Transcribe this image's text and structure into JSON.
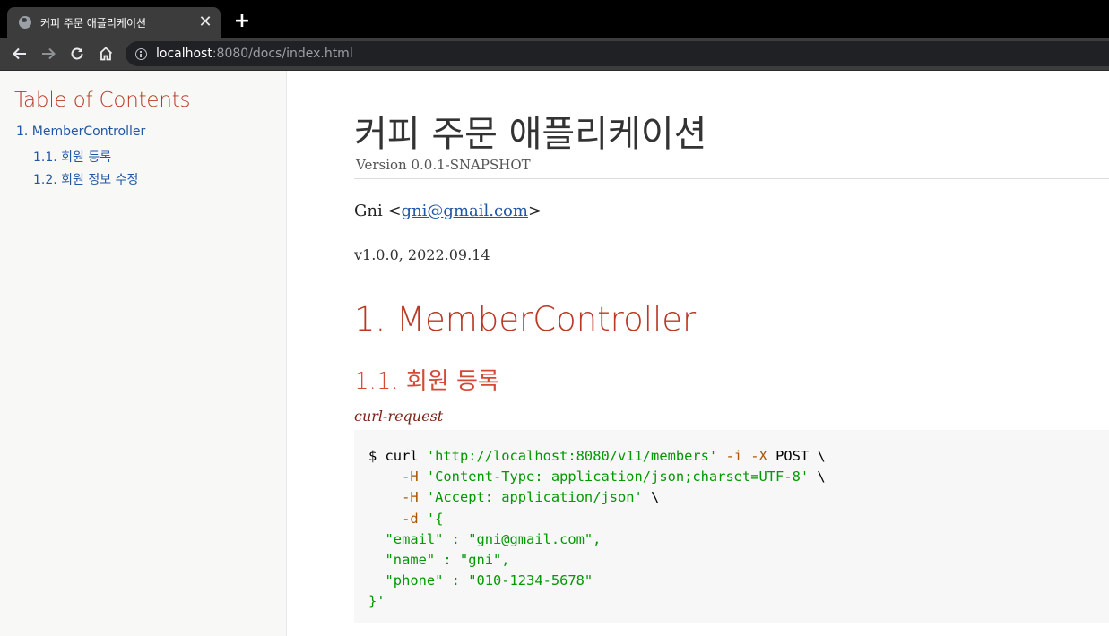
{
  "browser": {
    "tab_title": "커피 주문 애플리케이션",
    "tab_close": "✕",
    "new_tab": "+",
    "url_host": "localhost",
    "url_rest": ":8080/docs/index.html"
  },
  "toc": {
    "title": "Table of Contents",
    "items": [
      {
        "label": "1. MemberController"
      },
      {
        "label": "1.1. 회원 등록"
      },
      {
        "label": "1.2. 회원 정보 수정"
      }
    ]
  },
  "doc": {
    "title": "커피 주문 애플리케이션",
    "version": "Version 0.0.1-SNAPSHOT",
    "author_name": "Gni <",
    "author_email": "gni@gmail.com",
    "author_close": ">",
    "revision": "v1.0.0, 2022.09.14",
    "section_1": "1. MemberController",
    "section_1_1": "1.1. 회원 등록",
    "block_title": "curl-request",
    "code": {
      "l1_cmd": "$ curl ",
      "l1_url": "'http://localhost:8080/v11/members'",
      "l1_opt": " -i -X",
      "l1_tail": " POST \\",
      "l2_opt": "    -H ",
      "l2_str": "'Content-Type: application/json;charset=UTF-8'",
      "l2_tail": " \\",
      "l3_opt": "    -H ",
      "l3_str": "'Accept: application/json'",
      "l3_tail": " \\",
      "l4_opt": "    -d ",
      "l4_str": "'{",
      "l5": "  \"email\" : \"gni@gmail.com\",",
      "l6": "  \"name\" : \"gni\",",
      "l7": "  \"phone\" : \"010-1234-5678\"",
      "l8": "}'"
    }
  },
  "colors": {
    "heading_red": "#ba3925",
    "link_blue": "#2156a5",
    "code_string": "#009900"
  }
}
